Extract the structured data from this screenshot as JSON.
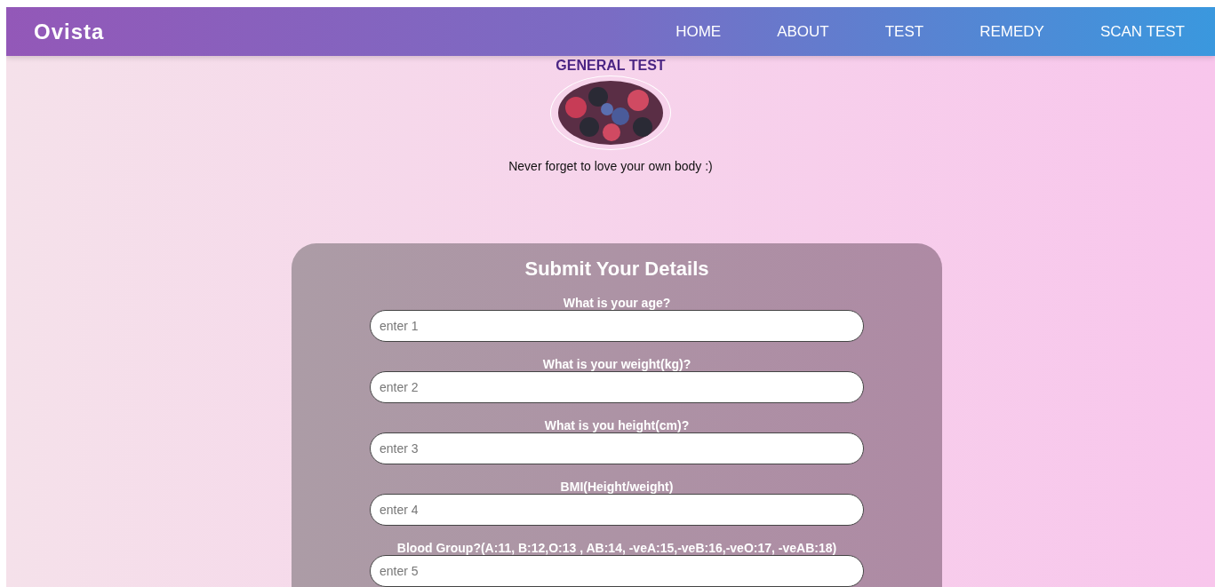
{
  "navbar": {
    "brand": "Ovista",
    "links": [
      "HOME",
      "ABOUT",
      "TEST",
      "REMEDY",
      "SCAN TEST"
    ]
  },
  "hero": {
    "title": "GENERAL TEST",
    "tagline": "Never forget to love your own body :)"
  },
  "form": {
    "title": "Submit Your Details",
    "fields": [
      {
        "label": "What is your age?",
        "placeholder": "enter 1"
      },
      {
        "label": "What is your weight(kg)?",
        "placeholder": "enter 2"
      },
      {
        "label": "What is you height(cm)?",
        "placeholder": "enter 3"
      },
      {
        "label": "BMI(Height/weight)",
        "placeholder": "enter 4"
      },
      {
        "label": "Blood Group?(A:11, B:12,O:13 , AB:14, -veA:15,-veB:16,-veO:17, -veAB:18)",
        "placeholder": "enter 5"
      }
    ]
  }
}
